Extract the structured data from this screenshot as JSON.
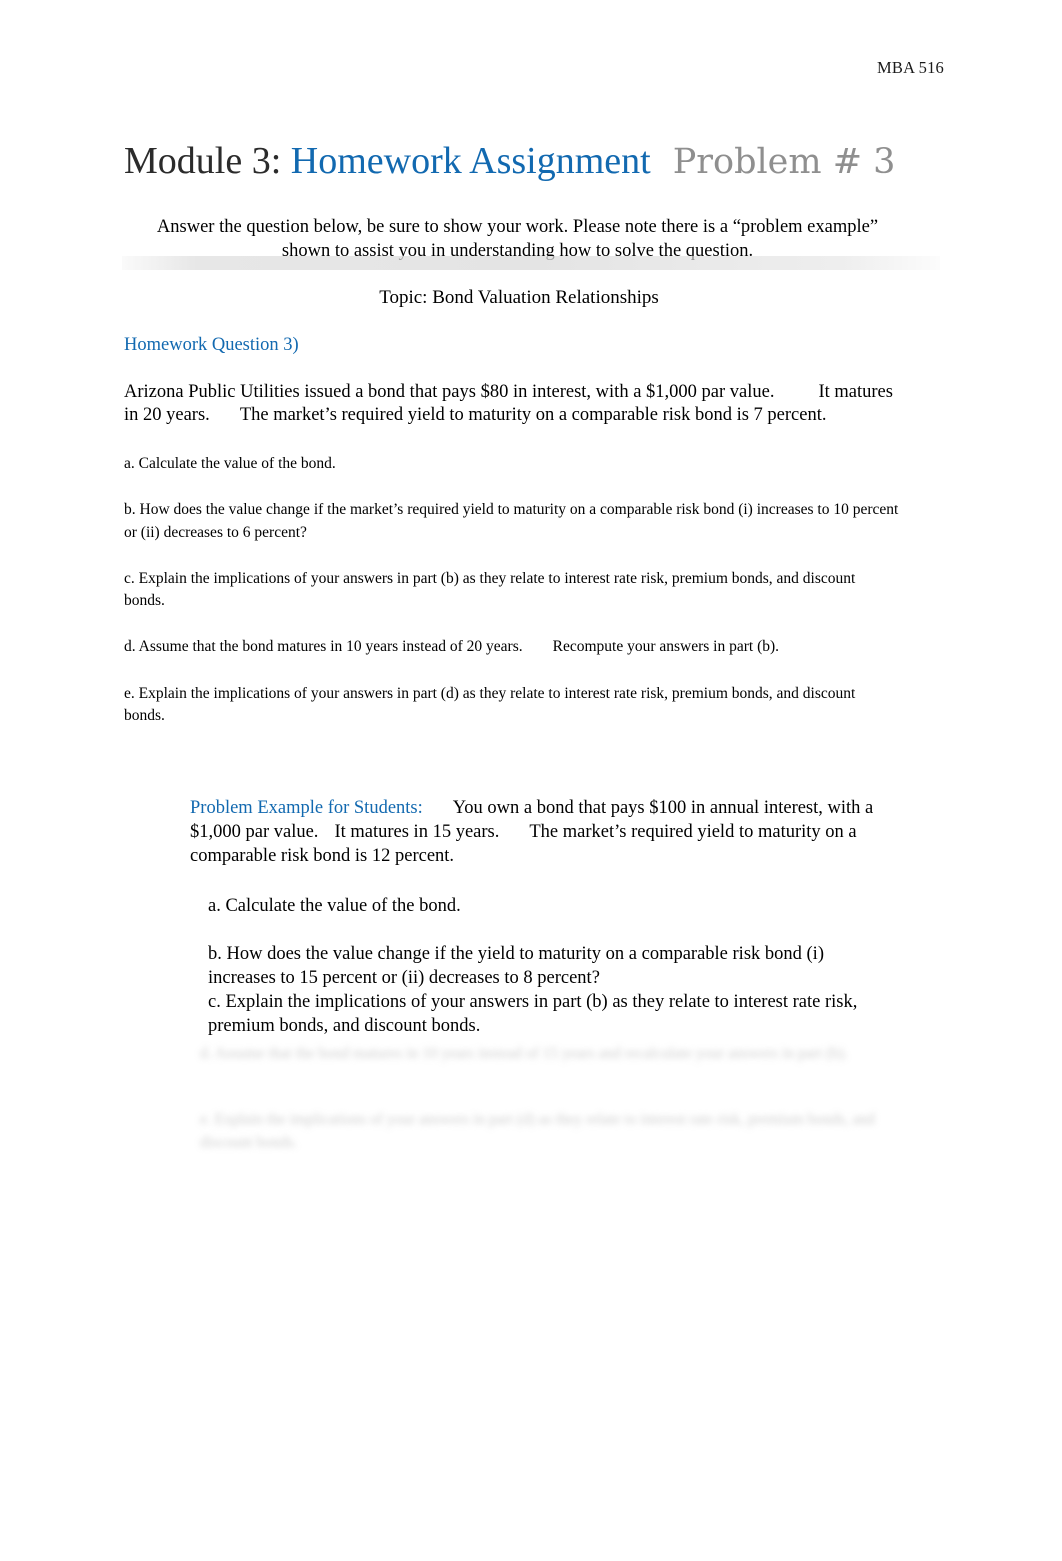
{
  "header": {
    "course_code": "MBA 516"
  },
  "title": {
    "module": "Module 3:",
    "assignment": "Homework Assignment",
    "problem": "Problem # 3"
  },
  "intro": {
    "text": "Answer the question below, be sure to show your work. Please note there is a “problem example” shown to assist you in understanding how to solve the question."
  },
  "topic": {
    "text": "Topic: Bond Valuation Relationships"
  },
  "section": {
    "heading": "Homework Question 3)"
  },
  "question": {
    "intro_part1": "Arizona Public Utilities issued a bond that pays $80 in interest, with a $1,000 par value.",
    "intro_part2": "It matures in 20 years.",
    "intro_part3": "The market’s required yield to maturity on a comparable risk bond is 7 percent.",
    "parts": [
      {
        "label": "a.",
        "text": "a. Calculate the value of the bond."
      },
      {
        "label": "b.",
        "text": "b. How does the value change if the market’s required yield to maturity on a comparable risk bond (i) increases to 10 percent or (ii) decreases to 6 percent?"
      },
      {
        "label": "c.",
        "text": "c. Explain the implications of your answers in part (b) as they relate to interest rate risk, premium bonds, and discount bonds."
      },
      {
        "label": "d.",
        "text_part1": "d. Assume that the bond matures in 10 years instead of 20 years.",
        "text_part2": "Recompute your answers in part (b)."
      },
      {
        "label": "e.",
        "text": "e. Explain the implications of your answers in part (d) as they relate to interest rate risk, premium bonds, and discount bonds."
      }
    ]
  },
  "example": {
    "label": "Problem Example for Students:",
    "lead_part1": "You own a bond that pays $100 in annual interest, with a $1,000 par value.",
    "lead_part2": "It matures in 15 years.",
    "lead_part3": "The market’s required yield to maturity on a comparable risk bond is 12 percent.",
    "parts": [
      {
        "label": "a.",
        "text": "a. Calculate the value of the bond."
      },
      {
        "label": "b.",
        "text": "b. How does the value change if the yield to maturity on a comparable risk bond (i) increases to 15 percent or (ii) decreases to 8 percent?"
      },
      {
        "label": "c.",
        "text": "c. Explain the implications of your answers in part (b) as they relate to interest rate risk, premium bonds, and discount bonds."
      }
    ],
    "redacted": [
      {
        "label": "d.",
        "text": "d. Assume that the bond matures in 10 years instead of 15 years and recalculate your answers in part (b)."
      },
      {
        "label": "e.",
        "text": "e. Explain the implications of your answers in part (d) as they relate to interest rate risk, premium bonds, and discount bonds."
      }
    ]
  }
}
